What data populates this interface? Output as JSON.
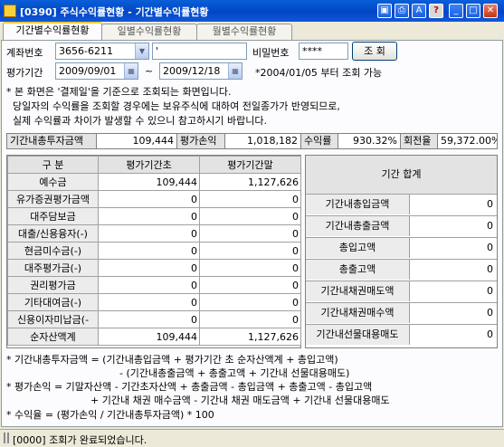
{
  "window": {
    "title": "[0390] 주식수익률현황 - 기간별수익률현황"
  },
  "tabs": [
    {
      "label": "기간별수익률현황",
      "active": true
    },
    {
      "label": "일별수익률현황",
      "active": false
    },
    {
      "label": "월별수익률현황",
      "active": false
    }
  ],
  "form": {
    "account_label": "계좌번호",
    "account_value": "3656-6211",
    "account_name_value": "'",
    "password_label": "비밀번호",
    "password_value": "****",
    "query_button": "조  회",
    "period_label": "평가기간",
    "date_from": "2009/09/01",
    "date_to": "2009/12/18",
    "tilde": "~",
    "period_note": "*2004/01/05 부터 조회 가능"
  },
  "notice": {
    "line1": "* 본 화면은 '결제일'을 기준으로 조회되는 화면입니다.",
    "line2": "  당일자의 수익률을 조회할 경우에는 보유주식에 대하여 전일종가가 반영되므로,",
    "line3": "  실제 수익률과 차이가 발생할 수 있으니 참고하시기 바랍니다."
  },
  "summary": {
    "total_invest_label": "기간내총투자금액",
    "total_invest_value": "109,444",
    "eval_pl_label": "평가손익",
    "eval_pl_value": "1,018,182",
    "return_label": "수익률",
    "return_value": "930.32%",
    "turnover_label": "회전율",
    "turnover_value": "59,372.00%"
  },
  "left_table": {
    "headers": [
      "구 분",
      "평가기간초",
      "평가기간말"
    ],
    "rows": [
      {
        "label": "예수금",
        "start": "109,444",
        "end": "1,127,626"
      },
      {
        "label": "유가증권평가금액",
        "start": "0",
        "end": "0"
      },
      {
        "label": "대주담보금",
        "start": "0",
        "end": "0"
      },
      {
        "label": "대출/신용융자(-)",
        "start": "0",
        "end": "0"
      },
      {
        "label": "현금미수금(-)",
        "start": "0",
        "end": "0"
      },
      {
        "label": "대주평가금(-)",
        "start": "0",
        "end": "0"
      },
      {
        "label": "권리평가금",
        "start": "0",
        "end": "0"
      },
      {
        "label": "기타대여금(-)",
        "start": "0",
        "end": "0"
      },
      {
        "label": "신용이자미납금(-",
        "start": "0",
        "end": "0"
      }
    ],
    "total": {
      "label": "순자산액계",
      "start": "109,444",
      "end": "1,127,626"
    }
  },
  "right_table": {
    "title": "기간 합계",
    "rows": [
      {
        "label": "기간내총입금액",
        "value": "0"
      },
      {
        "label": "기간내총출금액",
        "value": "0"
      },
      {
        "label": "총입고액",
        "value": "0"
      },
      {
        "label": "총출고액",
        "value": "0"
      },
      {
        "label": "기간내채권매도액",
        "value": "0"
      },
      {
        "label": "기간내채권매수액",
        "value": "0"
      },
      {
        "label": "기간내선물대용매도",
        "value": "0"
      }
    ]
  },
  "formulas": {
    "line1": "* 기간내총투자금액 = (기간내총입금액 + 평가기간 초 순자산액계 + 총입고액)",
    "line2": "- (기간내총출금액 + 총출고액 + 기간내 선물대용매도)",
    "line3": "* 평가손익 = 기말자산액 -  기간초자산액 + 총출금액 - 총입금액 + 총출고액 - 총입고액",
    "line4": "+ 기간내 채권 매수금액 - 기간내 채권 매도금액 + 기간내 선물대용매도",
    "line5": "* 수익율 = (평가손익 / 기간내총투자금액) * 100"
  },
  "status": {
    "message": "[0000] 조회가 완료되었습니다."
  },
  "colors": {
    "titlebar": "#0046c6",
    "panel": "#fcfcfe",
    "label_cell": "#e3e3e3",
    "active_tab_accent": "#ffc83c"
  }
}
